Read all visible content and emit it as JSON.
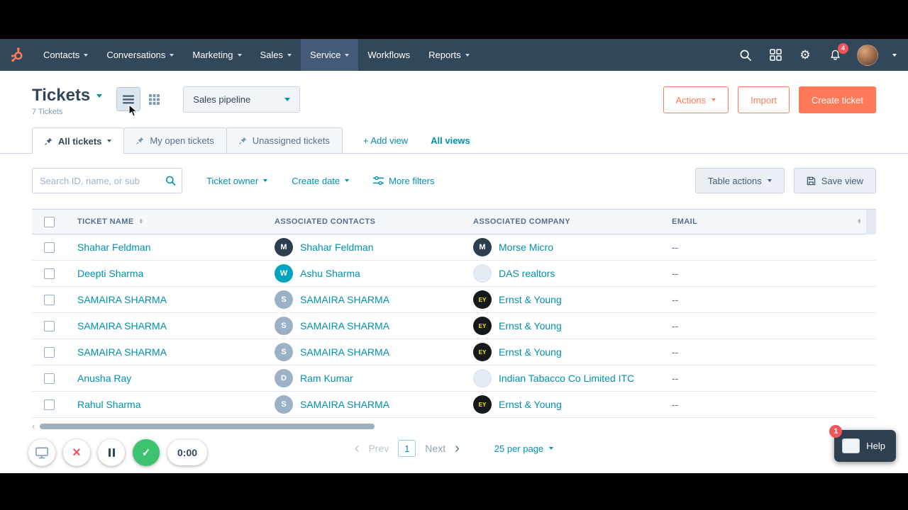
{
  "nav": {
    "items": [
      {
        "label": "Contacts",
        "caret": true,
        "active": false
      },
      {
        "label": "Conversations",
        "caret": true,
        "active": false
      },
      {
        "label": "Marketing",
        "caret": true,
        "active": false
      },
      {
        "label": "Sales",
        "caret": true,
        "active": false
      },
      {
        "label": "Service",
        "caret": true,
        "active": true
      },
      {
        "label": "Workflows",
        "caret": false,
        "active": false
      },
      {
        "label": "Reports",
        "caret": true,
        "active": false
      }
    ],
    "notification_badge": "4"
  },
  "header": {
    "title": "Tickets",
    "count_label": "7 Tickets",
    "pipeline_label": "Sales pipeline",
    "actions_label": "Actions",
    "import_label": "Import",
    "create_ticket_label": "Create ticket"
  },
  "views": {
    "tabs": [
      {
        "label": "All tickets",
        "active": true,
        "caret": true
      },
      {
        "label": "My open tickets",
        "active": false,
        "caret": false
      },
      {
        "label": "Unassigned tickets",
        "active": false,
        "caret": false
      }
    ],
    "add_view_label": "+ Add view",
    "all_views_label": "All views"
  },
  "filters": {
    "search_placeholder": "Search ID, name, or sub",
    "ticket_owner_label": "Ticket owner",
    "create_date_label": "Create date",
    "more_filters_label": "More filters",
    "table_actions_label": "Table actions",
    "save_view_label": "Save view"
  },
  "table": {
    "columns": [
      "TICKET NAME",
      "ASSOCIATED CONTACTS",
      "ASSOCIATED COMPANY",
      "EMAIL"
    ],
    "rows": [
      {
        "name": "Shahar Feldman",
        "contact": {
          "name": "Shahar Feldman",
          "avatar": {
            "text": "M",
            "bg": "#2d3e50",
            "fg": "#ffffff"
          }
        },
        "company": {
          "name": "Morse Micro",
          "avatar": {
            "text": "M",
            "bg": "#2d3e50",
            "fg": "#ffffff"
          }
        },
        "email": "--"
      },
      {
        "name": "Deepti Sharma",
        "contact": {
          "name": "Ashu Sharma",
          "avatar": {
            "text": "W",
            "bg": "#00a4bd",
            "fg": "#ffffff"
          }
        },
        "company": {
          "name": "DAS realtors",
          "avatar": {
            "text": "",
            "bg": "#e5ebf2",
            "fg": "#7c98b6"
          }
        },
        "email": "--"
      },
      {
        "name": "SAMAIRA SHARMA",
        "contact": {
          "name": "SAMAIRA SHARMA",
          "avatar": {
            "text": "S",
            "bg": "#9cb0c6",
            "fg": "#ffffff"
          }
        },
        "company": {
          "name": "Ernst & Young",
          "avatar": {
            "text": "EY",
            "bg": "#15191c",
            "fg": "#ffe600"
          }
        },
        "email": "--"
      },
      {
        "name": "SAMAIRA SHARMA",
        "contact": {
          "name": "SAMAIRA SHARMA",
          "avatar": {
            "text": "S",
            "bg": "#9cb0c6",
            "fg": "#ffffff"
          }
        },
        "company": {
          "name": "Ernst & Young",
          "avatar": {
            "text": "EY",
            "bg": "#15191c",
            "fg": "#ffe600"
          }
        },
        "email": "--"
      },
      {
        "name": "SAMAIRA SHARMA",
        "contact": {
          "name": "SAMAIRA SHARMA",
          "avatar": {
            "text": "S",
            "bg": "#9cb0c6",
            "fg": "#ffffff"
          }
        },
        "company": {
          "name": "Ernst & Young",
          "avatar": {
            "text": "EY",
            "bg": "#15191c",
            "fg": "#ffe600"
          }
        },
        "email": "--"
      },
      {
        "name": "Anusha Ray",
        "contact": {
          "name": "Ram Kumar",
          "avatar": {
            "text": "D",
            "bg": "#9cb0c6",
            "fg": "#ffffff"
          }
        },
        "company": {
          "name": "Indian Tabacco Co Limited ITC",
          "avatar": {
            "text": "",
            "bg": "#e5ebf2",
            "fg": "#7c98b6"
          }
        },
        "email": "--"
      },
      {
        "name": "Rahul Sharma",
        "contact": {
          "name": "SAMAIRA SHARMA",
          "avatar": {
            "text": "S",
            "bg": "#9cb0c6",
            "fg": "#ffffff"
          }
        },
        "company": {
          "name": "Ernst & Young",
          "avatar": {
            "text": "EY",
            "bg": "#15191c",
            "fg": "#ffe600"
          }
        },
        "email": "--"
      }
    ]
  },
  "pagination": {
    "prev_label": "Prev",
    "page": "1",
    "next_label": "Next",
    "page_size_label": "25 per page"
  },
  "recorder": {
    "timer": "0:00"
  },
  "help": {
    "label": "Help",
    "badge": "1"
  },
  "colors": {
    "accent_orange": "#ff7a59",
    "link_teal": "#0091ae",
    "nav_navy": "#33475b"
  }
}
